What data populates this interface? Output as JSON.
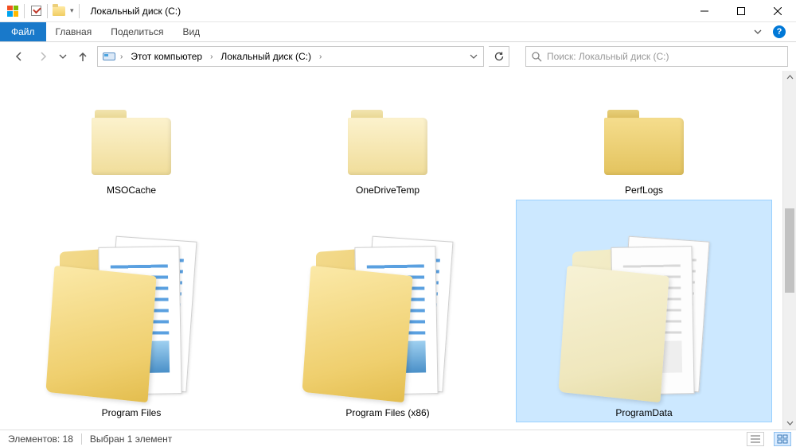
{
  "window": {
    "title": "Локальный диск (C:)"
  },
  "ribbon": {
    "file": "Файл",
    "tabs": [
      "Главная",
      "Поделиться",
      "Вид"
    ]
  },
  "breadcrumb": {
    "items": [
      "Этот компьютер",
      "Локальный диск (C:)"
    ]
  },
  "search": {
    "placeholder": "Поиск: Локальный диск (C:)"
  },
  "folders_row1": [
    {
      "name": "MSOCache",
      "variant": "light"
    },
    {
      "name": "OneDriveTemp",
      "variant": "light"
    },
    {
      "name": "PerfLogs",
      "variant": "dark"
    }
  ],
  "folders_row2": [
    {
      "name": "Program Files",
      "selected": false,
      "variant": "docs"
    },
    {
      "name": "Program Files (x86)",
      "selected": false,
      "variant": "docs"
    },
    {
      "name": "ProgramData",
      "selected": true,
      "variant": "docs-light"
    }
  ],
  "status": {
    "count_label": "Элементов:",
    "count_value": "18",
    "selection": "Выбран 1 элемент"
  }
}
